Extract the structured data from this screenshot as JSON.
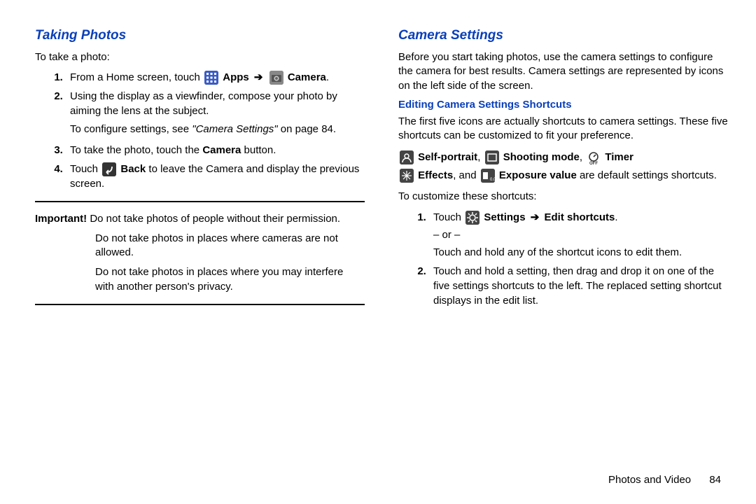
{
  "left": {
    "heading": "Taking Photos",
    "intro": "To take a photo:",
    "steps": [
      {
        "pre": "From a Home screen, touch ",
        "apps": "Apps",
        "arrow": "➔",
        "camera": "Camera",
        "post": "."
      },
      {
        "text": "Using the display as a viewfinder, compose your photo by aiming the lens at the subject.",
        "note_pre": "To configure settings, see ",
        "note_ital": "\"Camera Settings\"",
        "note_post": " on page 84."
      },
      {
        "pre": "To take the photo, touch the ",
        "bold": "Camera",
        "post": " button."
      },
      {
        "pre": "Touch ",
        "bold": "Back",
        "post": " to leave the Camera and display the previous screen."
      }
    ],
    "important_label": "Important!",
    "important1": " Do not take photos of people without their permission.",
    "important2": "Do not take photos in places where cameras are not allowed.",
    "important3": "Do not take photos in places where you may interfere with another person's privacy."
  },
  "right": {
    "heading": "Camera Settings",
    "para1": "Before you start taking photos, use the camera settings to configure the camera for best results. Camera settings are represented by icons on the left side of the screen.",
    "sub": "Editing Camera Settings Shortcuts",
    "para2": "The first five icons are actually shortcuts to camera settings. These five shortcuts can be customized to fit your preference.",
    "sc": {
      "self": "Self-portrait",
      "mode": "Shooting mode",
      "timer": "Timer",
      "effects": "Effects",
      "and": ", and ",
      "exposure": "Exposure value",
      "tail": " are default settings shortcuts."
    },
    "custom": "To customize these shortcuts:",
    "step1_pre": "Touch ",
    "step1_bold1": "Settings",
    "step1_arrow": "➔",
    "step1_bold2": "Edit shortcuts",
    "step1_post": ".",
    "or": "– or –",
    "step1b": "Touch and hold any of the shortcut icons to edit them.",
    "step2": "Touch and hold a setting, then drag and drop it on one of the five settings shortcuts to the left. The replaced setting shortcut displays in the edit list."
  },
  "footer": {
    "section": "Photos and Video",
    "page": "84"
  }
}
